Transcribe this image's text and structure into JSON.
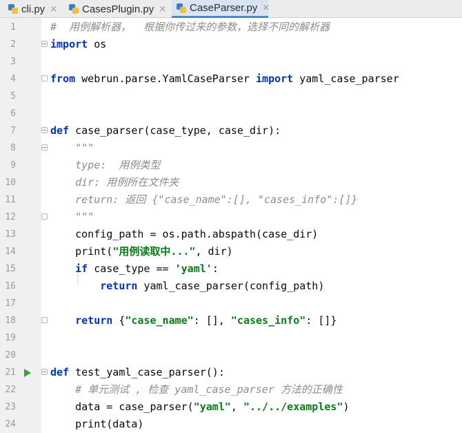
{
  "tabs": [
    {
      "label": "cli.py",
      "close": "×",
      "active": false
    },
    {
      "label": "CasesPlugin.py",
      "close": "×",
      "active": false
    },
    {
      "label": "CaseParser.py",
      "close": "×",
      "active": true
    }
  ],
  "lines": [
    {
      "number": "1",
      "tokens": [
        {
          "t": "#  用例解析器，  根据你传过来的参数，选择不同的解析器",
          "c": "cm"
        }
      ]
    },
    {
      "number": "2",
      "fold": "start",
      "tokens": [
        {
          "t": "import",
          "c": "kw"
        },
        {
          "t": " os",
          "c": ""
        }
      ]
    },
    {
      "number": "3",
      "tokens": []
    },
    {
      "number": "4",
      "fold": "end",
      "tokens": [
        {
          "t": "from",
          "c": "kw"
        },
        {
          "t": " webrun.parse.YamlCaseParser ",
          "c": ""
        },
        {
          "t": "import",
          "c": "kw"
        },
        {
          "t": " yaml_case_parser",
          "c": ""
        }
      ]
    },
    {
      "number": "5",
      "tokens": []
    },
    {
      "number": "6",
      "tokens": []
    },
    {
      "number": "7",
      "fold": "start",
      "tokens": [
        {
          "t": "def",
          "c": "kw"
        },
        {
          "t": " case_parser(case_type, case_dir):",
          "c": ""
        }
      ]
    },
    {
      "number": "8",
      "fold": "start",
      "tokens": [
        {
          "t": "    \"\"\"",
          "c": "cm"
        }
      ]
    },
    {
      "number": "9",
      "tokens": [
        {
          "t": "    type:  用例类型",
          "c": "cm"
        }
      ]
    },
    {
      "number": "10",
      "tokens": [
        {
          "t": "    dir: 用例所在文件夹",
          "c": "cm"
        }
      ]
    },
    {
      "number": "11",
      "tokens": [
        {
          "t": "    return: 返回 {\"case_name\":[], \"cases_info\":[]}",
          "c": "cm"
        }
      ]
    },
    {
      "number": "12",
      "fold": "end",
      "tokens": [
        {
          "t": "    \"\"\"",
          "c": "cm"
        }
      ]
    },
    {
      "number": "13",
      "tokens": [
        {
          "t": "    config_path = os.path.abspath(case_dir)",
          "c": ""
        }
      ]
    },
    {
      "number": "14",
      "tokens": [
        {
          "t": "    print(",
          "c": ""
        },
        {
          "t": "\"用例读取中...\"",
          "c": "str"
        },
        {
          "t": ", dir)",
          "c": ""
        }
      ]
    },
    {
      "number": "15",
      "tokens": [
        {
          "t": "    ",
          "c": ""
        },
        {
          "t": "if",
          "c": "kw"
        },
        {
          "t": " case_type == ",
          "c": ""
        },
        {
          "t": "'yaml'",
          "c": "str"
        },
        {
          "t": ":",
          "c": ""
        }
      ]
    },
    {
      "number": "16",
      "tokens": [
        {
          "t": "        ",
          "c": ""
        },
        {
          "t": "return",
          "c": "kw"
        },
        {
          "t": " yaml_case_parser(config_path)",
          "c": ""
        }
      ]
    },
    {
      "number": "17",
      "tokens": []
    },
    {
      "number": "18",
      "fold": "end",
      "tokens": [
        {
          "t": "    ",
          "c": ""
        },
        {
          "t": "return",
          "c": "kw"
        },
        {
          "t": " {",
          "c": ""
        },
        {
          "t": "\"case_name\"",
          "c": "str"
        },
        {
          "t": ": [], ",
          "c": ""
        },
        {
          "t": "\"cases_info\"",
          "c": "str"
        },
        {
          "t": ": []}",
          "c": ""
        }
      ]
    },
    {
      "number": "19",
      "tokens": []
    },
    {
      "number": "20",
      "tokens": []
    },
    {
      "number": "21",
      "run": true,
      "fold": "start",
      "tokens": [
        {
          "t": "def",
          "c": "kw"
        },
        {
          "t": " test_yaml_case_parser():",
          "c": ""
        }
      ]
    },
    {
      "number": "22",
      "tokens": [
        {
          "t": "    # 单元测试 , 检查 yaml_case_parser 方法的正确性",
          "c": "cm"
        }
      ]
    },
    {
      "number": "23",
      "tokens": [
        {
          "t": "    data = case_parser(",
          "c": ""
        },
        {
          "t": "\"yaml\"",
          "c": "str"
        },
        {
          "t": ", ",
          "c": ""
        },
        {
          "t": "\"../../examples\"",
          "c": "str"
        },
        {
          "t": ")",
          "c": ""
        }
      ]
    },
    {
      "number": "24",
      "tokens": [
        {
          "t": "    print(data)",
          "c": ""
        }
      ]
    }
  ]
}
